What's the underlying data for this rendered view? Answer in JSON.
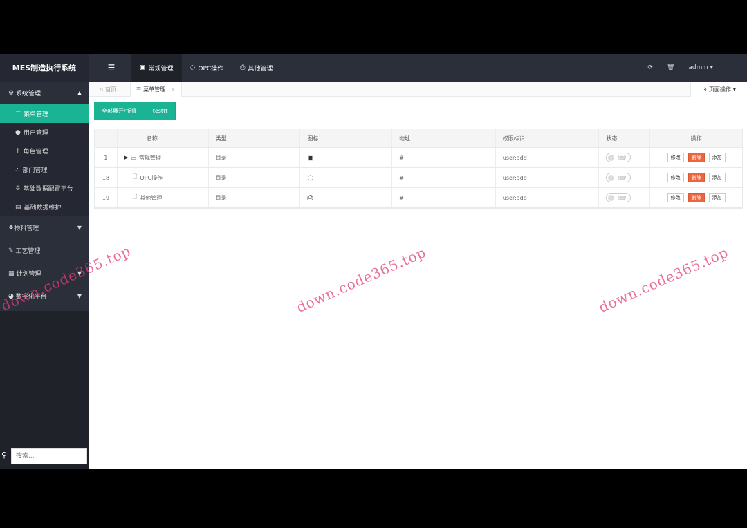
{
  "app": {
    "brand": "MES制造执行系统"
  },
  "topnav": [
    {
      "label": "常规管理",
      "icon": "book-icon",
      "active": true
    },
    {
      "label": "OPC操作",
      "icon": "leaf-icon",
      "active": false
    },
    {
      "label": "其他管理",
      "icon": "print-icon",
      "active": false
    }
  ],
  "topright": {
    "user": "admin"
  },
  "sidebar": {
    "groups": [
      {
        "label": "系统管理",
        "open": true,
        "items": [
          "菜单管理",
          "用户管理",
          "角色管理",
          "部门管理",
          "基础数据配置平台",
          "基础数据维护"
        ]
      },
      {
        "label": "物料管理"
      },
      {
        "label": "工艺管理"
      },
      {
        "label": "计划管理"
      },
      {
        "label": "数字化平台"
      }
    ],
    "search_placeholder": "搜索..."
  },
  "tabs": {
    "home": "首页",
    "current": "菜单管理",
    "page_ops": "页面操作"
  },
  "toolbar": {
    "expand": "全部展开/折叠",
    "test": "testtt"
  },
  "table": {
    "headers": [
      "",
      "名称",
      "类型",
      "图标",
      "地址",
      "权限标识",
      "状态",
      "操作"
    ],
    "rows": [
      {
        "id": "1",
        "name": "常规管理",
        "type": "目录",
        "icon": "book-icon",
        "url": "#",
        "perm": "user:add",
        "status": "锁定"
      },
      {
        "id": "18",
        "name": "OPC操作",
        "type": "目录",
        "icon": "leaf-icon",
        "url": "#",
        "perm": "user:add",
        "status": "锁定"
      },
      {
        "id": "19",
        "name": "其他管理",
        "type": "目录",
        "icon": "print-icon",
        "url": "#",
        "perm": "user:add",
        "status": "锁定"
      }
    ],
    "actions": {
      "edit": "修改",
      "delete": "删除",
      "add": "添加"
    }
  },
  "watermark": "down.code365.top",
  "colors": {
    "accent": "#1ab394",
    "danger": "#f0643c",
    "topbar": "#2b2f3a"
  }
}
